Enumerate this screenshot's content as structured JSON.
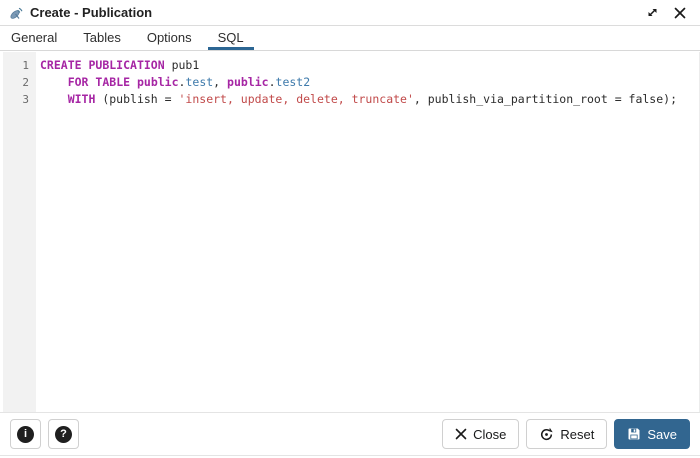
{
  "window": {
    "title": "Create - Publication",
    "icon": "publication-icon",
    "controls": {
      "expand_icon": "expand-icon",
      "close_icon": "close-icon"
    }
  },
  "tabs": [
    {
      "label": "General",
      "active": false
    },
    {
      "label": "Tables",
      "active": false
    },
    {
      "label": "Options",
      "active": false
    },
    {
      "label": "SQL",
      "active": true
    }
  ],
  "editor": {
    "language": "sql",
    "lines": [
      {
        "number": "1",
        "tokens": [
          {
            "text": "CREATE",
            "type": "keyword"
          },
          {
            "text": " ",
            "type": "plain"
          },
          {
            "text": "PUBLICATION",
            "type": "keyword"
          },
          {
            "text": " pub1",
            "type": "plain"
          }
        ]
      },
      {
        "number": "2",
        "tokens": [
          {
            "text": "    ",
            "type": "plain"
          },
          {
            "text": "FOR",
            "type": "keyword"
          },
          {
            "text": " ",
            "type": "plain"
          },
          {
            "text": "TABLE",
            "type": "keyword"
          },
          {
            "text": " ",
            "type": "plain"
          },
          {
            "text": "public",
            "type": "keyword"
          },
          {
            "text": ".",
            "type": "plain"
          },
          {
            "text": "test",
            "type": "name"
          },
          {
            "text": ", ",
            "type": "plain"
          },
          {
            "text": "public",
            "type": "keyword"
          },
          {
            "text": ".",
            "type": "plain"
          },
          {
            "text": "test2",
            "type": "name"
          }
        ]
      },
      {
        "number": "3",
        "tokens": [
          {
            "text": "    ",
            "type": "plain"
          },
          {
            "text": "WITH",
            "type": "keyword"
          },
          {
            "text": " (publish = ",
            "type": "plain"
          },
          {
            "text": "'insert, update, delete, truncate'",
            "type": "string"
          },
          {
            "text": ", publish_via_partition_root = false);",
            "type": "plain"
          }
        ]
      }
    ]
  },
  "footer": {
    "info_glyph": "i",
    "help_glyph": "?",
    "close_label": "Close",
    "reset_label": "Reset",
    "save_label": "Save",
    "icons": [
      "info-icon",
      "help-icon",
      "close-x-icon",
      "reset-icon",
      "save-icon"
    ]
  },
  "colors": {
    "accent": "#326690",
    "tab_underline": "#2c6693",
    "keyword": "#a626a4",
    "identifier_blue": "#3e7aab",
    "string_red": "#c14a4a",
    "gutter_bg": "#f2f2f2"
  }
}
